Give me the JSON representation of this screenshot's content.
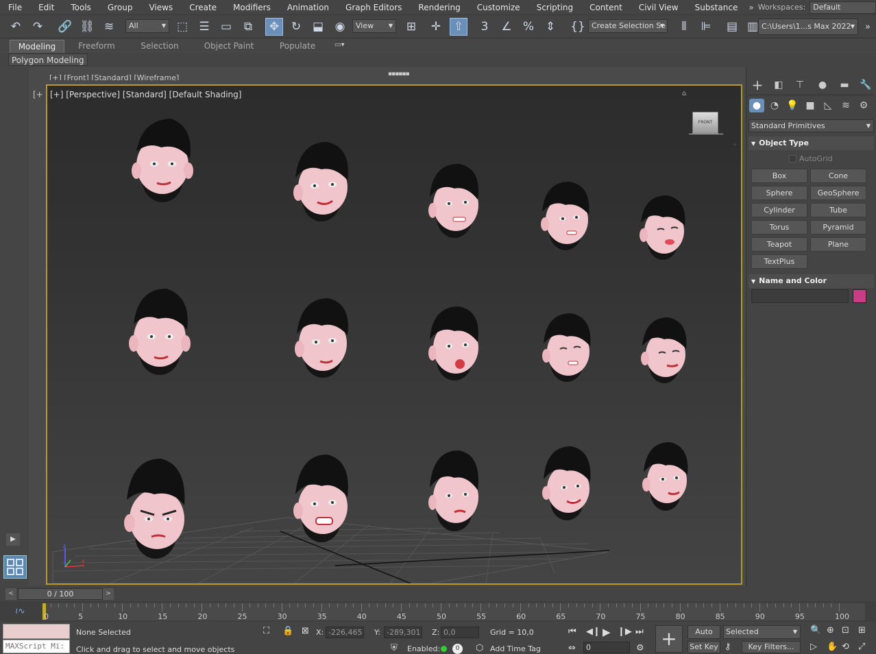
{
  "menu": [
    "File",
    "Edit",
    "Tools",
    "Group",
    "Views",
    "Create",
    "Modifiers",
    "Animation",
    "Graph Editors",
    "Rendering",
    "Customize",
    "Scripting",
    "Content",
    "Civil View",
    "Substance"
  ],
  "workspaces": {
    "label": "Workspaces:",
    "value": "Default"
  },
  "toolbar": {
    "selection_filter": "All",
    "ref_coord": "View",
    "selection_set": "Create Selection Se",
    "project_path": "C:\\Users\\1...s Max 2022"
  },
  "ribbon_tabs": [
    "Modeling",
    "Freeform",
    "Selection",
    "Object Paint",
    "Populate"
  ],
  "ribbon_panel": "Polygon Modeling",
  "viewport": {
    "top_label": "[+] [Front] [Standard] [Wireframe]",
    "left_label": "[+",
    "label": "[+] [Perspective] [Standard] [Default Shading]",
    "viewcube_label": "FRONT"
  },
  "command_panel": {
    "category": "Standard Primitives",
    "object_type_title": "Object Type",
    "autogrid": "AutoGrid",
    "primitives": [
      "Box",
      "Cone",
      "Sphere",
      "GeoSphere",
      "Cylinder",
      "Tube",
      "Torus",
      "Pyramid",
      "Teapot",
      "Plane",
      "TextPlus"
    ],
    "name_color_title": "Name and Color",
    "object_color": "#cc3b86"
  },
  "time": {
    "slider": "0 / 100",
    "ticks": [
      5,
      10,
      15,
      20,
      25,
      30,
      35,
      40,
      45,
      50,
      55,
      60,
      65,
      70,
      75,
      80,
      85,
      90,
      95,
      100
    ],
    "zero": "0"
  },
  "status": {
    "maxscript": "MAXScript Mi:",
    "selection": "None Selected",
    "prompt": "Click and drag to select and move objects",
    "x_label": "X:",
    "x_value": "-226,465",
    "y_label": "Y:",
    "y_value": "-289,301",
    "z_label": "Z:",
    "z_value": "0,0",
    "grid": "Grid = 10,0",
    "enabled": "Enabled:",
    "add_time_tag": "Add Time Tag",
    "frame": "0",
    "auto_key": "Auto Key",
    "selected": "Selected",
    "set_key": "Set Key",
    "key_filters": "Key Filters..."
  }
}
